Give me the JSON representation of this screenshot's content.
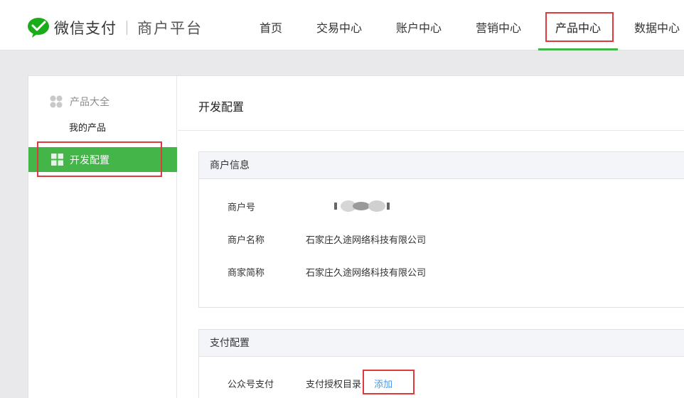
{
  "header": {
    "brand": "微信支付",
    "subtitle": "商户平台",
    "nav": [
      "首页",
      "交易中心",
      "账户中心",
      "营销中心",
      "产品中心",
      "数据中心"
    ],
    "active_nav": "产品中心",
    "accent": "#44b549",
    "annotation_color": "#e0393e"
  },
  "sidebar": {
    "group_label": "产品大全",
    "sub_item": "我的产品",
    "active_item": "开发配置"
  },
  "content": {
    "title": "开发配置",
    "merchant_panel": {
      "title": "商户信息",
      "rows": [
        {
          "label": "商户号",
          "value": ""
        },
        {
          "label": "商户名称",
          "value": "石家庄久途网络科技有限公司"
        },
        {
          "label": "商家简称",
          "value": "石家庄久途网络科技有限公司"
        }
      ]
    },
    "pay_panel": {
      "title": "支付配置",
      "row_label": "公众号支付",
      "row_text": "支付授权目录",
      "add_link": "添加"
    }
  }
}
